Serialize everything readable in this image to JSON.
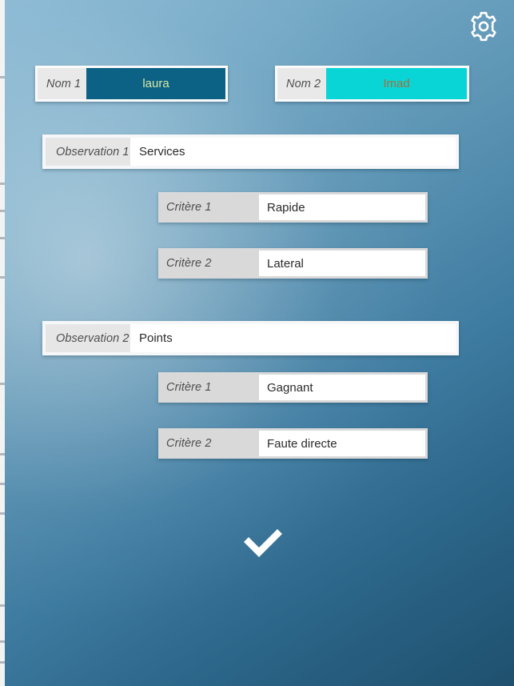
{
  "app": {
    "background_gradient_from": "#8bb9d4",
    "background_gradient_to": "#1f506e"
  },
  "header": {
    "settings_icon": "gear-icon"
  },
  "names": [
    {
      "label": "Nom 1",
      "value": "laura",
      "field_color": "#0b6285",
      "text_color": "#d9e8a4"
    },
    {
      "label": "Nom 2",
      "value": "Imad",
      "field_color": "#0ad5d6",
      "text_color": "#a0703e"
    }
  ],
  "observations": [
    {
      "label": "Observation 1",
      "value": "Services",
      "criteria": [
        {
          "label": "Critère 1",
          "value": "Rapide"
        },
        {
          "label": "Critère 2",
          "value": "Lateral"
        }
      ]
    },
    {
      "label": "Observation 2",
      "value": "Points",
      "criteria": [
        {
          "label": "Critère 1",
          "value": "Gagnant"
        },
        {
          "label": "Critère 2",
          "value": "Faute directe"
        }
      ]
    }
  ],
  "footer": {
    "confirm_icon": "check-icon"
  }
}
